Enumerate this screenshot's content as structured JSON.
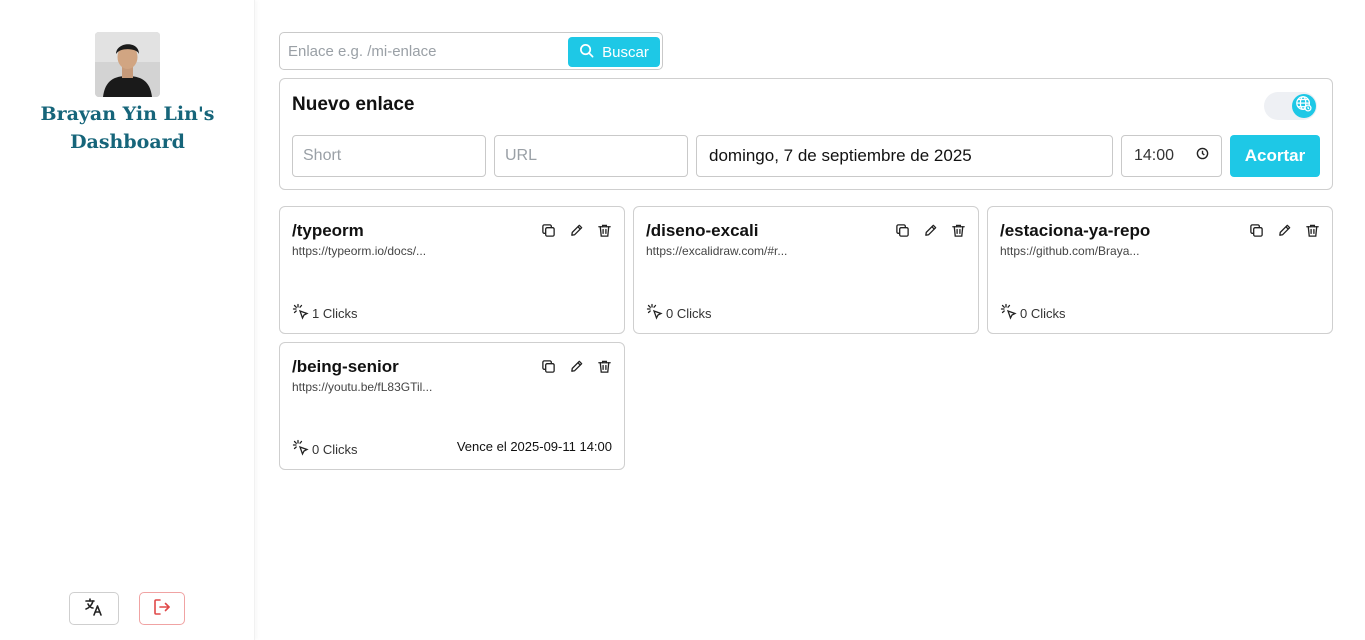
{
  "sidebar": {
    "title": "Brayan Yin Lin's Dashboard",
    "avatar_icon": "user-photo",
    "buttons": [
      {
        "icon": "translate-icon",
        "color": "#333333"
      },
      {
        "icon": "logout-icon",
        "color": "#e04848"
      }
    ]
  },
  "search": {
    "placeholder": "Enlace e.g. /mi-enlace",
    "value": "",
    "button_label": "Buscar"
  },
  "new_link": {
    "title": "Nuevo enlace",
    "short_placeholder": "Short",
    "url_placeholder": "URL",
    "date_value": "domingo, 7 de septiembre de 2025",
    "time_value": "14:00",
    "submit_label": "Acortar",
    "toggle_icon": "globe-icon",
    "toggle_on": true
  },
  "links": [
    {
      "slug": "/typeorm",
      "url": "https://typeorm.io/docs/...",
      "clicks": "1 Clicks",
      "expiry": ""
    },
    {
      "slug": "/diseno-excali",
      "url": "https://excalidraw.com/#r...",
      "clicks": "0 Clicks",
      "expiry": ""
    },
    {
      "slug": "/estaciona-ya-repo",
      "url": "https://github.com/Braya...",
      "clicks": "0 Clicks",
      "expiry": ""
    },
    {
      "slug": "/being-senior",
      "url": "https://youtu.be/fL83GTil...",
      "clicks": "0 Clicks",
      "expiry": "Vence el 2025-09-11 14:00"
    }
  ],
  "colors": {
    "accent": "#1ec8e6",
    "title": "#16657a",
    "danger": "#e04848"
  }
}
